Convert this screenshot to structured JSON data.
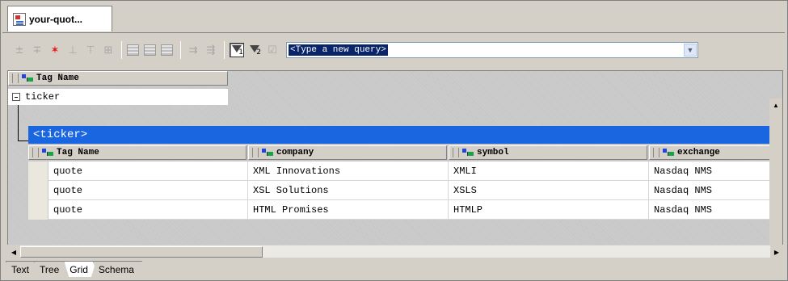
{
  "document_tab": {
    "title": "your-quot..."
  },
  "toolbar": {
    "query_placeholder": "<Type a new query>",
    "filter1_label": "1",
    "filter2_label": "2"
  },
  "grid": {
    "root_header": "Tag Name",
    "root_value": "ticker",
    "group_title": "<ticker>",
    "columns": [
      "Tag Name",
      "company",
      "symbol",
      "exchange"
    ],
    "rows": [
      [
        "quote",
        "XML Innovations",
        "XMLI",
        "Nasdaq NMS"
      ],
      [
        "quote",
        "XSL Solutions",
        "XSLS",
        "Nasdaq NMS"
      ],
      [
        "quote",
        "HTML Promises",
        "HTMLP",
        "Nasdaq NMS"
      ]
    ]
  },
  "view_tabs": [
    {
      "label": "Text",
      "active": false
    },
    {
      "label": "Tree",
      "active": false
    },
    {
      "label": "Grid",
      "active": true
    },
    {
      "label": "Schema",
      "active": false
    }
  ]
}
